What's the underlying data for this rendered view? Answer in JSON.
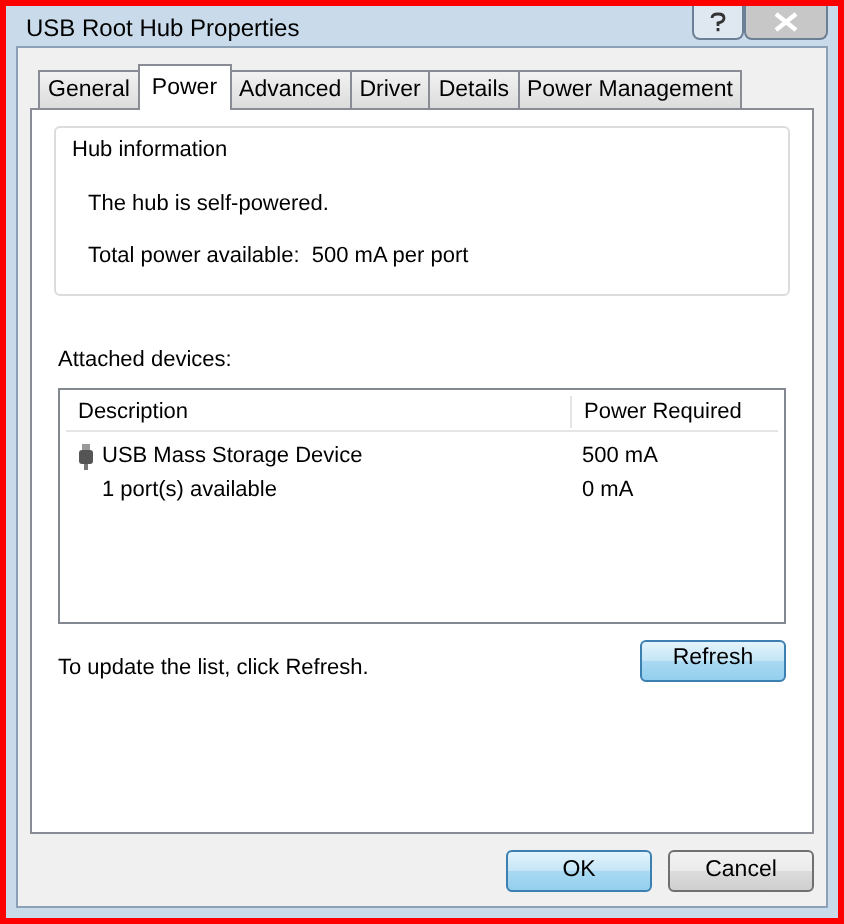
{
  "window": {
    "title": "USB Root Hub Properties"
  },
  "title_buttons": [
    {
      "kind": "help"
    },
    {
      "kind": "close"
    }
  ],
  "tabs": [
    {
      "label": "General",
      "selected": false
    },
    {
      "label": "Power",
      "selected": true
    },
    {
      "label": "Advanced",
      "selected": false
    },
    {
      "label": "Driver",
      "selected": false
    },
    {
      "label": "Details",
      "selected": false
    },
    {
      "label": "Power Management",
      "selected": false
    }
  ],
  "hub_information": {
    "title": "Hub information",
    "lines": [
      "The hub is self-powered.",
      "Total power available:  500 mA per port"
    ]
  },
  "attached_devices": {
    "label": "Attached devices:",
    "columns": [
      "Description",
      "Power Required"
    ],
    "rows": [
      {
        "description": "USB Mass Storage Device",
        "power": "500 mA",
        "icon": true
      },
      {
        "description": "1 port(s) available",
        "power": "0 mA",
        "icon": false
      }
    ]
  },
  "refresh_hint": "To update the list, click Refresh.",
  "refresh_button": "Refresh",
  "buttons": [
    {
      "label": "OK",
      "default": true
    },
    {
      "label": "Cancel",
      "default": false
    }
  ]
}
